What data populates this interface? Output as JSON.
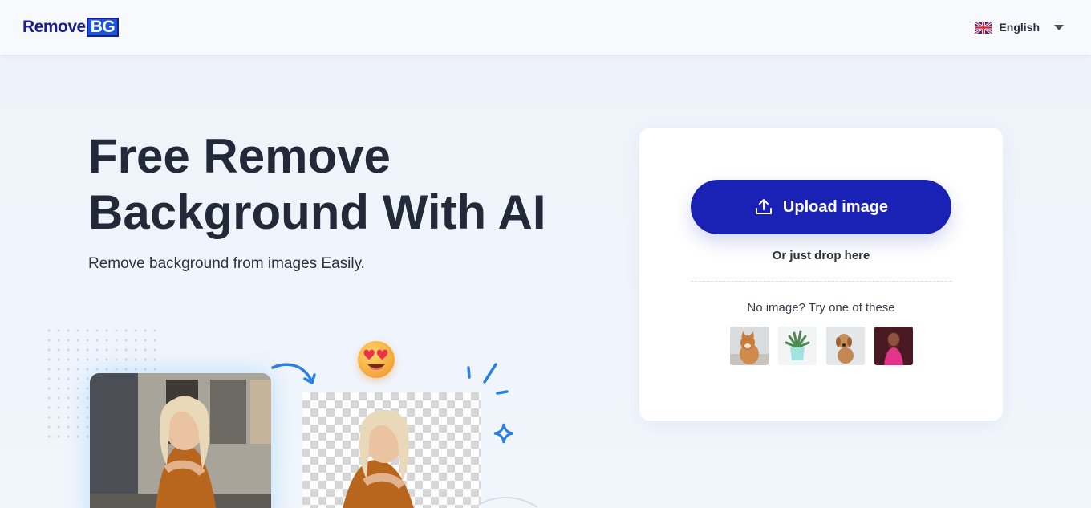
{
  "header": {
    "logo_part1": "Remove",
    "logo_part2": "BG",
    "language": "English",
    "flag_icon": "uk-flag-icon",
    "caret_icon": "chevron-down-icon"
  },
  "hero": {
    "title_line1": "Free Remove",
    "title_line2": "Background With AI",
    "subtitle": "Remove background from images Easily."
  },
  "upload_card": {
    "upload_label": "Upload image",
    "upload_icon": "upload-icon",
    "drop_text": "Or just drop here",
    "try_text": "No image? Try one of these",
    "samples": [
      "sample-cat",
      "sample-plant",
      "sample-dog",
      "sample-woman"
    ]
  },
  "colors": {
    "primary": "#1a22b5",
    "logo_dark": "#1b1d8a",
    "logo_accent": "#1a56db",
    "title": "#222938",
    "decor_blue": "#2a7fe0"
  }
}
